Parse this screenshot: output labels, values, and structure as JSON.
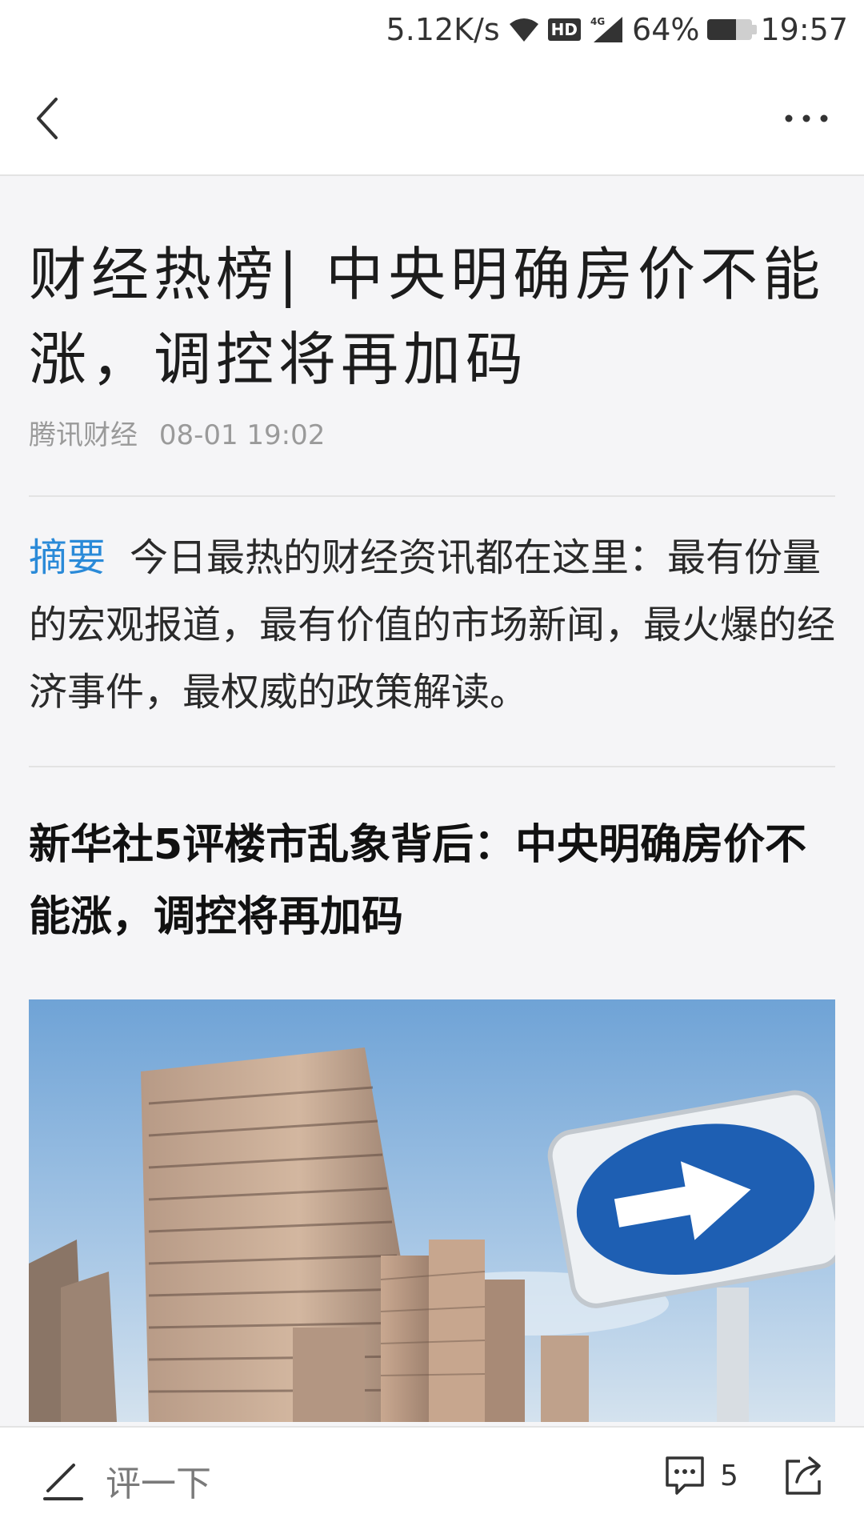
{
  "status_bar": {
    "network_speed": "5.12K/s",
    "hd_badge": "HD",
    "network_type": "4G",
    "battery": "64%",
    "battery_level": 0.64,
    "time": "19:57"
  },
  "nav": {
    "back_icon": "chevron-left-icon",
    "more_icon": "more-horizontal-icon"
  },
  "article": {
    "title": "财经热榜| 中央明确房价不能涨，调控将再加码",
    "source": "腾讯财经",
    "date": "08-01 19:02",
    "abstract_label": "摘要",
    "abstract_text": "今日最热的财经资讯都在这里：最有份量的宏观报道，最有价值的市场新闻，最火爆的经济事件，最权威的政策解读。",
    "subheading": "新华社5评楼市乱象背后：中央明确房价不能涨，调控将再加码"
  },
  "bottom_bar": {
    "comment_placeholder": "评一下",
    "comment_count": "5",
    "comment_icon": "comment-bubble-icon",
    "pen_icon": "pen-icon",
    "share_icon": "share-icon"
  },
  "colors": {
    "accent": "#2a8ad8",
    "background": "#f5f5f7",
    "text": "#1c1c1c",
    "meta_text": "#9a9a9a"
  }
}
